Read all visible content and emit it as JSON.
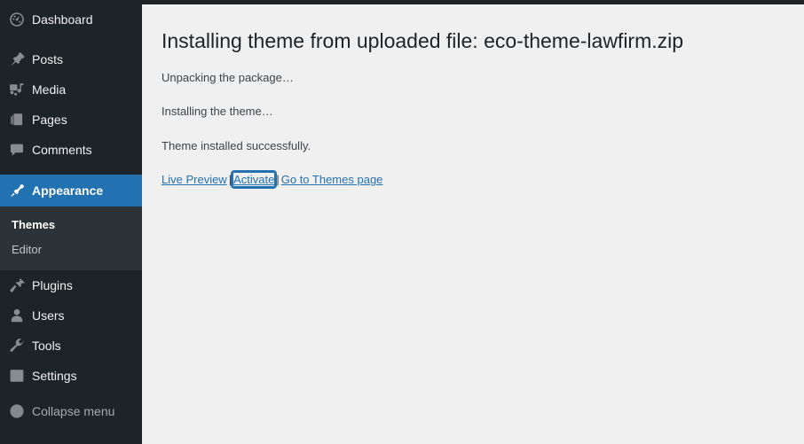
{
  "adminbar": {
    "present": true
  },
  "colors": {
    "sidebar_bg": "#1d2327",
    "submenu_bg": "#2c3338",
    "accent_blue": "#2271b1",
    "content_bg": "#f0f0f1",
    "text_dark": "#3c434a",
    "icon_gray": "#a7aaad"
  },
  "sidebar": {
    "items": [
      {
        "label": "Dashboard",
        "icon": "dashboard-icon",
        "current": false,
        "spaced": false
      },
      {
        "label": "Posts",
        "icon": "pin-icon",
        "current": false,
        "spaced": true
      },
      {
        "label": "Media",
        "icon": "media-icon",
        "current": false,
        "spaced": false
      },
      {
        "label": "Pages",
        "icon": "pages-icon",
        "current": false,
        "spaced": false
      },
      {
        "label": "Comments",
        "icon": "comments-icon",
        "current": false,
        "spaced": false
      },
      {
        "label": "Appearance",
        "icon": "paintbrush-icon",
        "current": true,
        "spaced": true
      }
    ],
    "submenu": [
      {
        "label": "Themes",
        "current": true
      },
      {
        "label": "Editor",
        "current": false
      }
    ],
    "items_after": [
      {
        "label": "Plugins",
        "icon": "plugin-icon",
        "current": false,
        "spaced": false
      },
      {
        "label": "Users",
        "icon": "user-icon",
        "current": false,
        "spaced": false
      },
      {
        "label": "Tools",
        "icon": "wrench-icon",
        "current": false,
        "spaced": false
      },
      {
        "label": "Settings",
        "icon": "sliders-icon",
        "current": false,
        "spaced": false
      }
    ],
    "collapse": {
      "label": "Collapse menu",
      "icon": "collapse-arrow-icon"
    }
  },
  "main": {
    "title": "Installing theme from uploaded file: eco-theme-lawfirm.zip",
    "status_lines": [
      "Unpacking the package…",
      "Installing the theme…",
      "Theme installed successfully."
    ],
    "actions": {
      "live_preview": "Live Preview",
      "activate": "Activate",
      "go_to_themes": "Go to Themes page",
      "separator": "|",
      "focused": "Activate"
    }
  }
}
